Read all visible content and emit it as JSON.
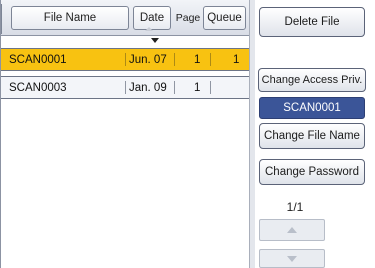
{
  "header": {
    "file_name": "File Name",
    "date": "Date",
    "page": "Page",
    "queue": "Queue"
  },
  "rows": [
    {
      "file": "SCAN0001",
      "date": "Jun. 07",
      "page": "1",
      "queue": "1",
      "selected": true
    },
    {
      "file": "SCAN0003",
      "date": "Jan. 09",
      "page": "1",
      "queue": "",
      "selected": false
    }
  ],
  "panel": {
    "delete_file": "Delete File",
    "change_access": "Change Access Priv.",
    "selected_name": "SCAN0001",
    "change_file_name": "Change File Name",
    "change_password": "Change Password",
    "page_indicator": "1/1"
  },
  "colors": {
    "selected_row": "#f8c211",
    "name_display": "#3b5598"
  },
  "icons": {
    "sort": "triangle-down-icon",
    "scroll_up": "triangle-up-icon",
    "scroll_down": "triangle-down-icon"
  }
}
